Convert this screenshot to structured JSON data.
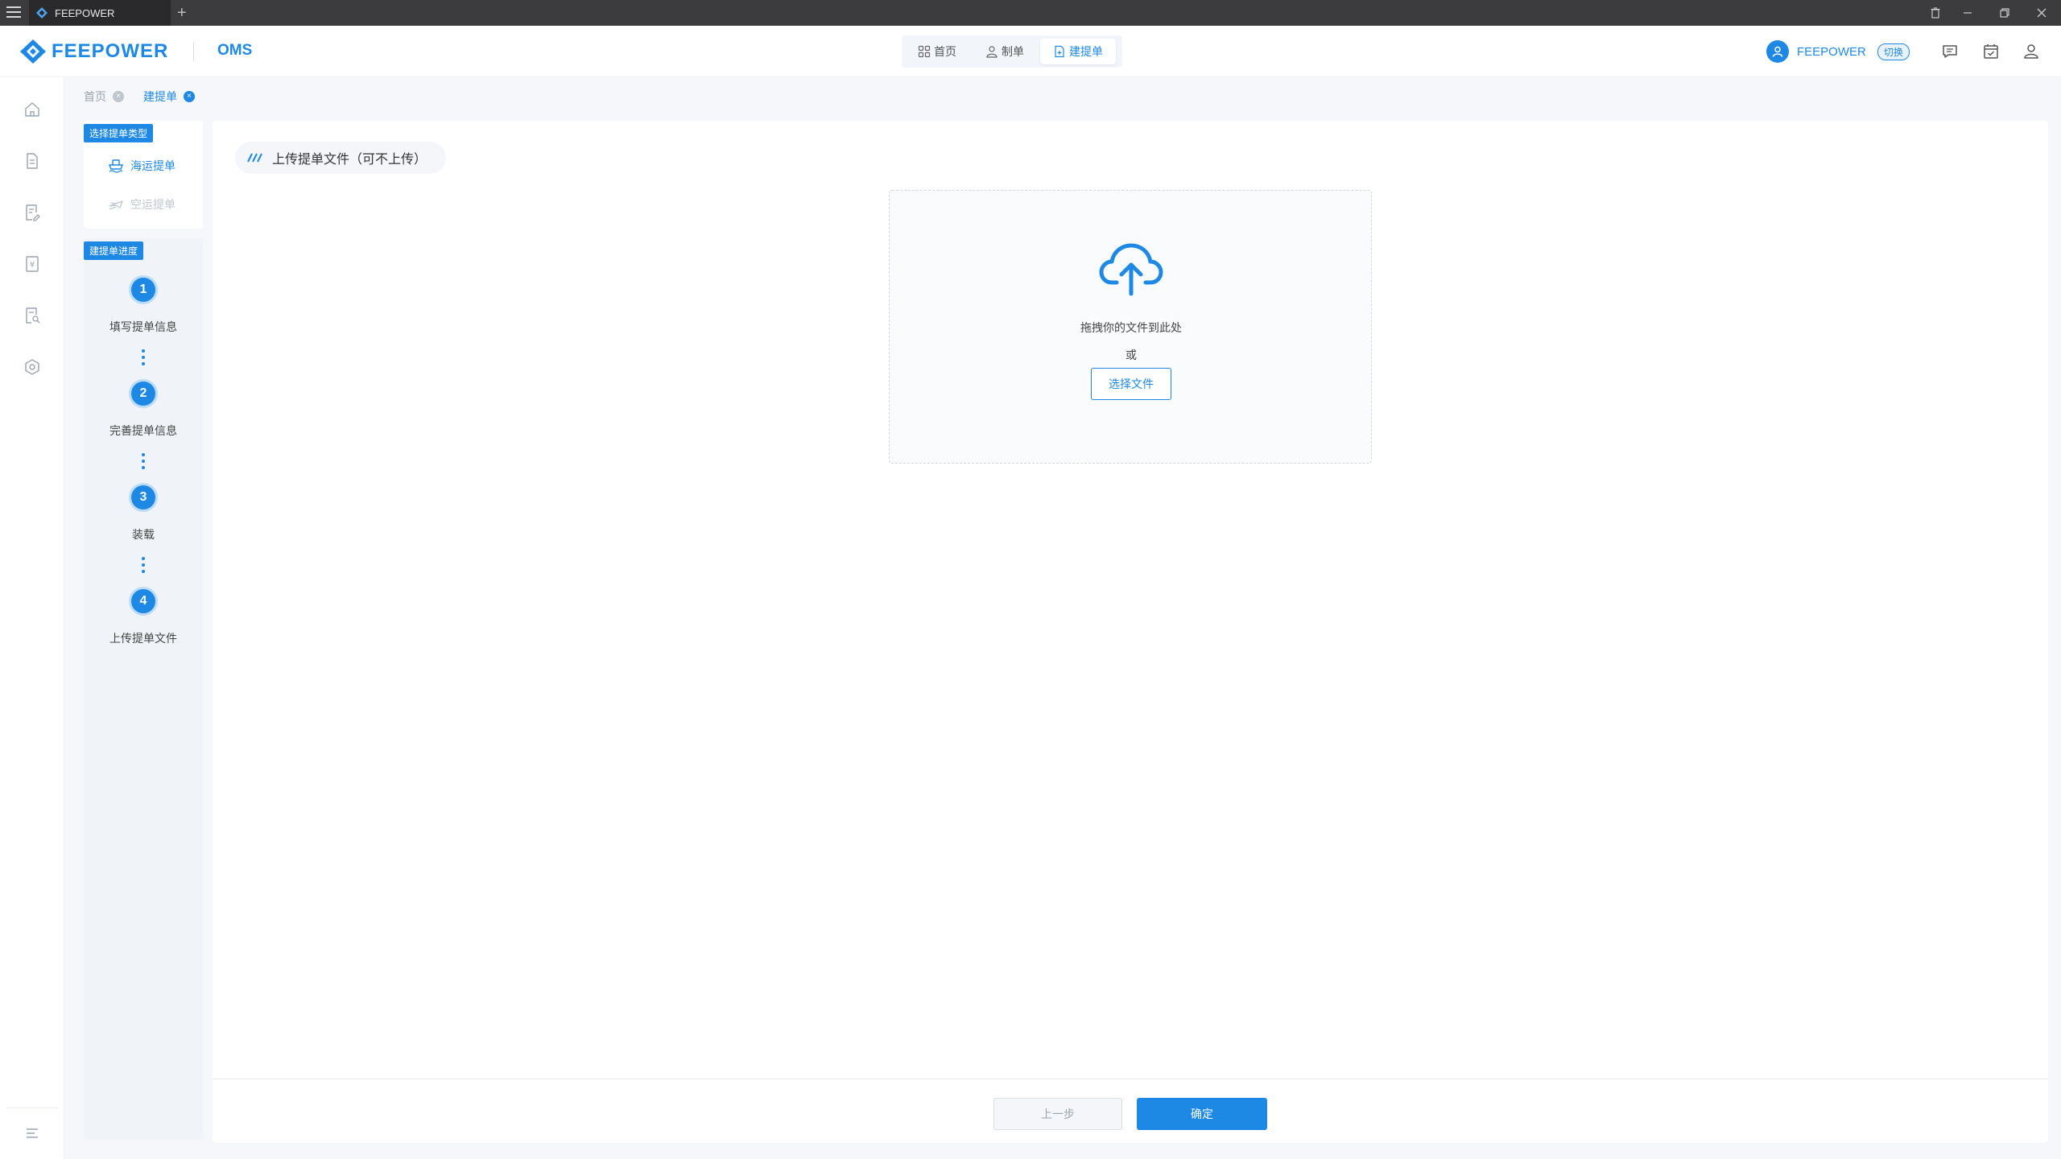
{
  "titlebar": {
    "tab_title": "FEEPOWER",
    "new_tab": "+",
    "controls": [
      "trash",
      "minimize",
      "restore",
      "close"
    ]
  },
  "header": {
    "brand": "FEEPOWER",
    "app_name": "OMS",
    "nav": [
      {
        "label": "首页",
        "icon": "grid-icon",
        "active": false
      },
      {
        "label": "制单",
        "icon": "person-doc-icon",
        "active": false
      },
      {
        "label": "建提单",
        "icon": "doc-add-icon",
        "active": true
      }
    ],
    "user_name": "FEEPOWER",
    "switch_label": "切换",
    "right_icons": [
      "message-icon",
      "calendar-check-icon",
      "user-icon"
    ]
  },
  "sidebar_icons": [
    "home-icon",
    "document-icon",
    "edit-document-icon",
    "invoice-icon",
    "search-document-icon",
    "settings-hexagon-icon",
    "menu-expand-icon"
  ],
  "breadcrumbs": [
    {
      "label": "首页",
      "active": false
    },
    {
      "label": "建提单",
      "active": true
    }
  ],
  "type_panel": {
    "badge": "选择提单类型",
    "items": [
      {
        "label": "海运提单",
        "icon": "ship-icon",
        "state": "active"
      },
      {
        "label": "空运提单",
        "icon": "plane-icon",
        "state": "disabled"
      }
    ]
  },
  "progress_panel": {
    "badge": "建提单进度",
    "steps": [
      {
        "number": "1",
        "label": "填写提单信息"
      },
      {
        "number": "2",
        "label": "完善提单信息"
      },
      {
        "number": "3",
        "label": "装载"
      },
      {
        "number": "4",
        "label": "上传提单文件"
      }
    ]
  },
  "main": {
    "section_title": "上传提单文件（可不上传）",
    "upload": {
      "drag_text": "拖拽你的文件到此处",
      "or_text": "或",
      "button": "选择文件"
    },
    "prev_button": "上一步",
    "confirm_button": "确定"
  },
  "colors": {
    "primary": "#1e88e5",
    "titlebar": "#3c3c3f",
    "background": "#f5f7fa"
  }
}
